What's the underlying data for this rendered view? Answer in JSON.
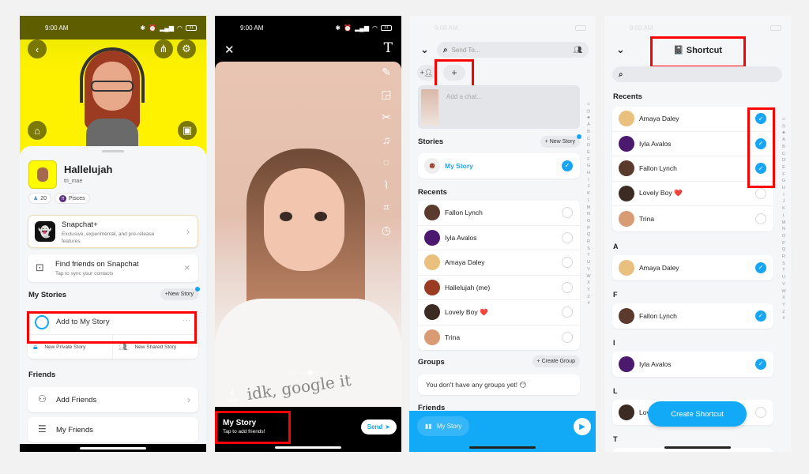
{
  "status_bar": {
    "time": "9:00 AM",
    "battery": "31"
  },
  "panel1": {
    "profile": {
      "display_name": "Hallelujah",
      "username": "tri_mae",
      "friend_score": "20",
      "zodiac": "Pisces"
    },
    "snapchat_plus": {
      "title": "Snapchat+",
      "subtitle": "Exclusive, experimental, and pre-release features."
    },
    "find_friends": {
      "title": "Find friends on Snapchat",
      "subtitle": "Tap to sync your contacts"
    },
    "my_stories": {
      "heading": "My Stories",
      "new_story_label": "+New Story",
      "add_to_story": "Add to My Story",
      "new_private": "New Private Story",
      "new_shared": "New Shared Story"
    },
    "friends": {
      "heading": "Friends",
      "add_friends": "Add Friends",
      "my_friends": "My Friends"
    }
  },
  "panel2": {
    "shirt_text": "idk, google it",
    "save_label": "Save",
    "story_title": "My Story",
    "story_subtitle": "Tap to add friends!",
    "send_label": "Send",
    "carousel_dots": "○○○○◉○○○"
  },
  "panel3": {
    "search_placeholder": "Send To...",
    "add_chat_placeholder": "Add a chat...",
    "stories_heading": "Stories",
    "new_story_label": "+ New Story",
    "my_story": "My Story",
    "recents_heading": "Recents",
    "recents": [
      {
        "name": "Fallon Lynch",
        "avatar_color": "#5a3a2c",
        "checked": false
      },
      {
        "name": "Iyla Avalos",
        "avatar_color": "#4b1a6e",
        "checked": false
      },
      {
        "name": "Amaya Daley",
        "avatar_color": "#e9c07e",
        "checked": false
      },
      {
        "name": "Hallelujah (me)",
        "avatar_color": "#9a3b22",
        "checked": false
      },
      {
        "name": "Lovely Boy ❤️",
        "avatar_color": "#3b2b22",
        "checked": false
      },
      {
        "name": "Trina",
        "avatar_color": "#d99b73",
        "checked": false
      }
    ],
    "groups_heading": "Groups",
    "create_group_label": "+ Create Group",
    "no_groups_text": "You don't have any groups yet! 😶",
    "friends_heading": "Friends",
    "bottom_chip": "My Story",
    "alphabet": [
      "☺",
      "◷",
      "♣",
      "A",
      "B",
      "C",
      "D",
      "E",
      "F",
      "G",
      "H",
      "I",
      "J",
      "K",
      "L",
      "M",
      "N",
      "O",
      "P",
      "Q",
      "R",
      "S",
      "T",
      "U",
      "V",
      "W",
      "X",
      "Y",
      "Z",
      "#"
    ]
  },
  "panel4": {
    "title": "📓 Shortcut",
    "recents_heading": "Recents",
    "recents": [
      {
        "name": "Amaya Daley",
        "avatar_color": "#e9c07e",
        "checked": true
      },
      {
        "name": "Iyla Avalos",
        "avatar_color": "#4b1a6e",
        "checked": true
      },
      {
        "name": "Fallon Lynch",
        "avatar_color": "#5a3a2c",
        "checked": true
      },
      {
        "name": "Lovely Boy ❤️",
        "avatar_color": "#3b2b22",
        "checked": false
      },
      {
        "name": "Trina",
        "avatar_color": "#d99b73",
        "checked": false
      }
    ],
    "sections": [
      {
        "letter": "A",
        "name": "Amaya Daley",
        "avatar_color": "#e9c07e",
        "checked": true
      },
      {
        "letter": "F",
        "name": "Fallon Lynch",
        "avatar_color": "#5a3a2c",
        "checked": true
      },
      {
        "letter": "I",
        "name": "Iyla Avalos",
        "avatar_color": "#4b1a6e",
        "checked": true
      },
      {
        "letter": "L",
        "name": "Lovely Boy",
        "avatar_color": "#3b2b22",
        "checked": false
      },
      {
        "letter": "T",
        "name": "",
        "avatar_color": "#d99b73",
        "checked": false
      }
    ],
    "create_shortcut_label": "Create Shortcut"
  },
  "colors": {
    "snap_yellow": "#fffc00",
    "snap_blue": "#12aaf7",
    "highlight_red": "#ff0000"
  }
}
